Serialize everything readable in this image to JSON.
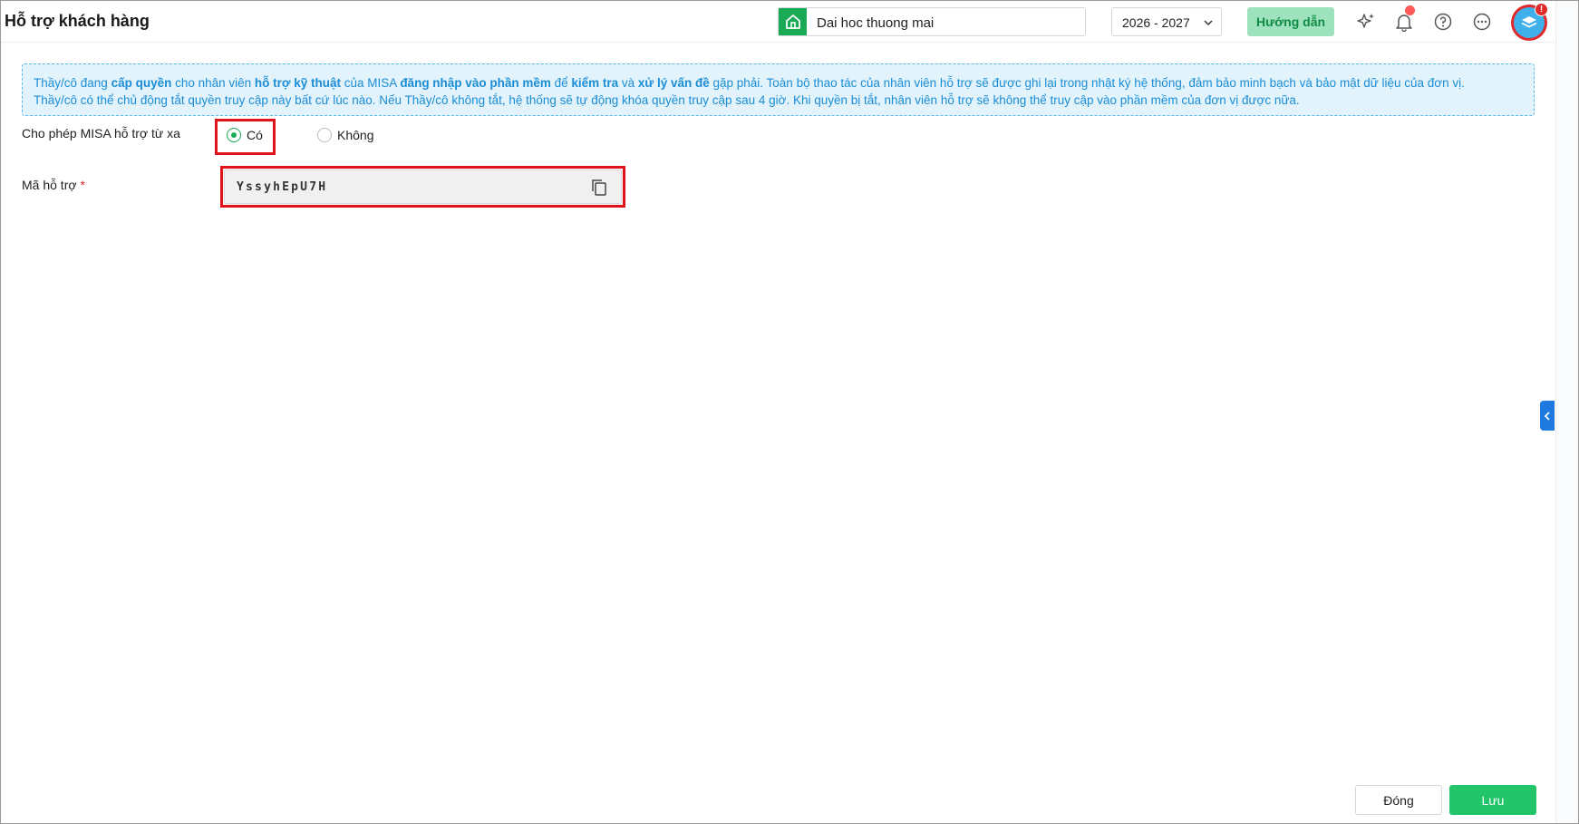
{
  "header": {
    "title": "Hỗ trợ khách hàng",
    "unit_name": "Dai hoc thuong mai",
    "school_year": "2026 - 2027",
    "guide_label": "Hướng dẫn",
    "avatar_badge": "!"
  },
  "info_banner": {
    "line1": [
      {
        "text": "Thầy/cô đang ",
        "bold": false
      },
      {
        "text": "cấp quyền",
        "bold": true
      },
      {
        "text": " cho nhân viên ",
        "bold": false
      },
      {
        "text": "hỗ trợ kỹ thuật",
        "bold": true
      },
      {
        "text": " của MISA ",
        "bold": false
      },
      {
        "text": "đăng nhập vào phần mềm",
        "bold": true
      },
      {
        "text": " để ",
        "bold": false
      },
      {
        "text": "kiểm tra",
        "bold": true
      },
      {
        "text": " và ",
        "bold": false
      },
      {
        "text": "xử lý vấn đề",
        "bold": true
      },
      {
        "text": " gặp phải. Toàn bộ thao tác của nhân viên hỗ trợ sẽ được ghi lại trong nhật ký hệ thống, đảm bảo minh bạch và bảo mật dữ liệu của đơn vị.",
        "bold": false
      }
    ],
    "line2": "Thầy/cô có thể chủ động tắt quyền truy cập này bất cứ lúc nào. Nếu Thầy/cô không tắt, hệ thống sẽ tự động khóa quyền truy cập sau 4 giờ. Khi quyền bị tắt, nhân viên hỗ trợ sẽ không thể truy cập vào phần mềm của đơn vị được nữa."
  },
  "form": {
    "remote_support_label": "Cho phép MISA hỗ trợ từ xa",
    "option_yes": "Có",
    "option_no": "Không",
    "selected": "yes",
    "support_code_label": "Mã hỗ trợ",
    "required_mark": "*",
    "support_code_value": "YssyhEpU7H"
  },
  "footer": {
    "close_label": "Đóng",
    "save_label": "Lưu"
  },
  "colors": {
    "accent_green": "#22c56a",
    "info_blue": "#1a8dd6",
    "highlight_red": "#e0121b"
  }
}
